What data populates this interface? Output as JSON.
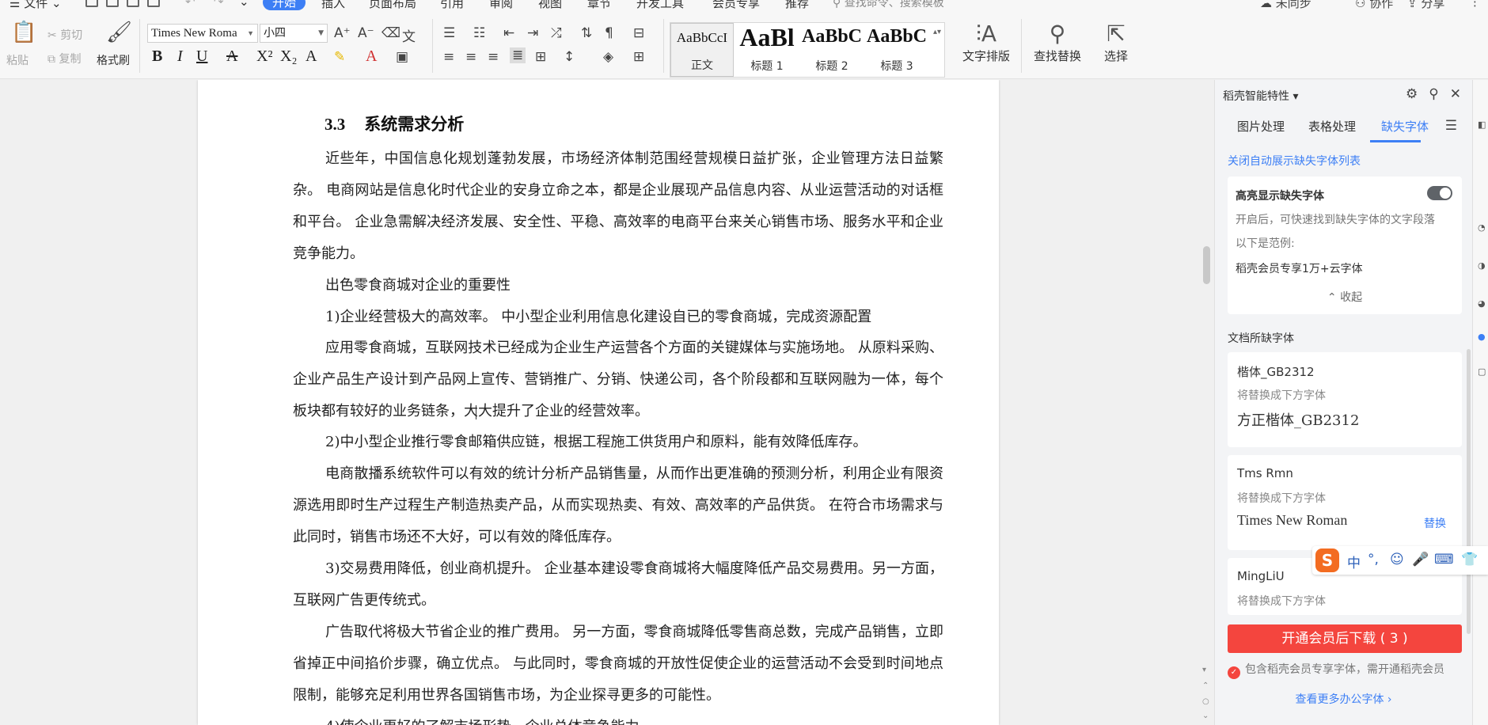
{
  "menu": {
    "file": "文件",
    "tabs": [
      "开始",
      "插入",
      "页面布局",
      "引用",
      "审阅",
      "视图",
      "章节",
      "开发工具",
      "会员专享",
      "推荐"
    ],
    "active_tab": "开始",
    "search_placeholder": "查找命令、搜索模板",
    "sync": "未同步",
    "collab": "协作",
    "share": "分享"
  },
  "ribbon": {
    "paste": "粘贴",
    "cut": "剪切",
    "copy": "复制",
    "format_painter": "格式刷",
    "font_name": "Times New Roma",
    "font_size": "小四",
    "styles": [
      {
        "preview": "AaBbCcI",
        "label": "正文"
      },
      {
        "preview": "AaBl",
        "label": "标题 1"
      },
      {
        "preview": "AaBbC",
        "label": "标题 2"
      },
      {
        "preview": "AaBbC",
        "label": "标题 3"
      }
    ],
    "text_layout": "文字排版",
    "find_replace": "查找替换",
    "select": "选择"
  },
  "document": {
    "heading_number": "3.3",
    "heading_text": "系统需求分析",
    "paragraphs": [
      {
        "indent": true,
        "text": "近些年，中国信息化规划蓬勃发展，市场经济体制范围经营规模日益扩张，企业管理方法日益繁杂。 电商网站是信息化时代企业的安身立命之本，都是企业展现产品信息内容、从业运营活动的对话框和平台。 企业急需解决经济发展、安全性、平稳、高效率的电商平台来关心销售市场、服务水平和企业竞争能力。"
      },
      {
        "indent": true,
        "text": "出色零食商城对企业的重要性"
      },
      {
        "indent": true,
        "text": "1)企业经营极大的高效率。 中小型企业利用信息化建设自已的零食商城，完成资源配置"
      },
      {
        "indent": true,
        "text": "应用零食商城，互联网技术已经成为企业生产运营各个方面的关键媒体与实施场地。 从原料采购、企业产品生产设计到产品网上宣传、营销推广、分销、快递公司，各个阶段都和互联网融为一体，每个板块都有较好的业务链条，大大提升了企业的经营效率。"
      },
      {
        "indent": true,
        "text": "2)中小型企业推行零食邮箱供应链，根据工程施工供货用户和原料，能有效降低库存。"
      },
      {
        "indent": true,
        "text": "电商散播系统软件可以有效的统计分析产品销售量，从而作出更准确的预测分析，利用企业有限资源选用即时生产过程生产制造热卖产品，从而实现热卖、有效、高效率的产品供货。 在符合市场需求与此同时，销售市场还不大好，可以有效的降低库存。"
      },
      {
        "indent": true,
        "text": "3)交易费用降低，创业商机提升。 企业基本建设零食商城将大幅度降低产品交易费用。另一方面，互联网广告更传统式。"
      },
      {
        "indent": true,
        "text": "广告取代将极大节省企业的推广费用。 另一方面，零食商城降低零售商总数，完成产品销售，立即省掉正中间掐价步骤，确立优点。 与此同时，零食商城的开放性促使企业的运营活动不会受到时间地点限制，能够充足利用世界各国销售市场，为企业探寻更多的可能性。"
      },
      {
        "indent": true,
        "text": "4)使企业更好的了解市场形势，企业总体竞争能力"
      }
    ]
  },
  "panel": {
    "title": "稻壳智能特性",
    "tabs": [
      "图片处理",
      "表格处理",
      "缺失字体"
    ],
    "active_tab": "缺失字体",
    "close_auto_link": "关闭自动展示缺失字体列表",
    "highlight": {
      "title": "高亮显示缺失字体",
      "desc": "开启后，可快速找到缺失字体的文字段落",
      "example_label": "以下是范例:",
      "example": "稻壳会员专享1万+云字体",
      "collapse": "收起"
    },
    "missing_label": "文档所缺字体",
    "fonts": [
      {
        "name": "楷体_GB2312",
        "hint": "将替换成下方字体",
        "replacement": "方正楷体_GB2312",
        "action": ""
      },
      {
        "name": "Tms Rmn",
        "hint": "将替换成下方字体",
        "replacement": "Times New Roman",
        "action": "替换"
      },
      {
        "name": "MingLiU",
        "hint": "将替换成下方字体",
        "replacement": "",
        "action": ""
      }
    ],
    "download_button": "开通会员后下载 ( 3 )",
    "note": "包含稻壳会员专享字体，需开通稻壳会员",
    "more_link": "查看更多办公字体 ›"
  },
  "ime": {
    "logo": "S",
    "items": [
      "中",
      "°,",
      "☺",
      "🎤",
      "⌨",
      "👕"
    ]
  },
  "colors": {
    "accent": "#3d7ff5",
    "download": "#f4453e",
    "ime_logo": "#f36c21"
  }
}
